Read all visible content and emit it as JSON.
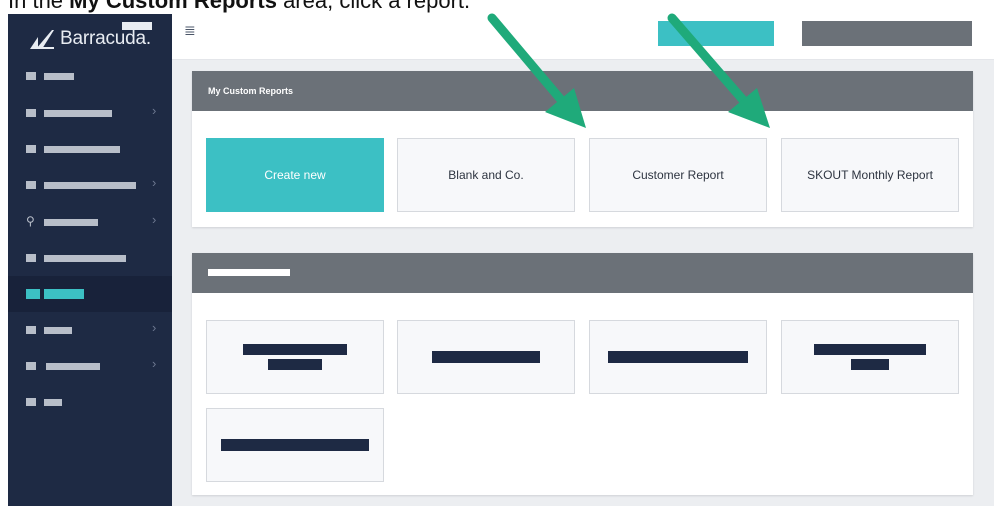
{
  "caption": {
    "prefix": "In the ",
    "bold": "My Custom Reports",
    "suffix": " area, click a report."
  },
  "brand": {
    "name": "Barracuda",
    "name_suffix": "."
  },
  "colors": {
    "sidebar": "#1e2a44",
    "accent": "#3cc0c4",
    "header_gray": "#6b7178",
    "arrow": "#1faa7a"
  },
  "topbar": {
    "menu_icon": "hamburger-icon"
  },
  "sidebar": {
    "items": [
      {
        "icon": "nav-icon",
        "has_chevron": false,
        "active": false
      },
      {
        "icon": "nav-icon",
        "has_chevron": true,
        "active": false
      },
      {
        "icon": "nav-icon",
        "has_chevron": false,
        "active": false
      },
      {
        "icon": "nav-icon",
        "has_chevron": true,
        "active": false
      },
      {
        "icon": "location-pin-icon",
        "has_chevron": true,
        "active": false
      },
      {
        "icon": "nav-icon",
        "has_chevron": false,
        "active": false
      },
      {
        "icon": "nav-icon",
        "has_chevron": false,
        "active": true
      },
      {
        "icon": "nav-icon",
        "has_chevron": true,
        "active": false
      },
      {
        "icon": "nav-icon",
        "has_chevron": true,
        "active": false
      },
      {
        "icon": "nav-icon",
        "has_chevron": false,
        "active": false
      }
    ],
    "chevron_glyph": "›",
    "pin_glyph": "⚲"
  },
  "custom_reports": {
    "title": "My Custom Reports",
    "tiles": [
      {
        "label": "Create new"
      },
      {
        "label": "Blank and Co."
      },
      {
        "label": "Customer Report"
      },
      {
        "label": "SKOUT Monthly Report"
      }
    ]
  },
  "hamburger_glyph": "≣"
}
